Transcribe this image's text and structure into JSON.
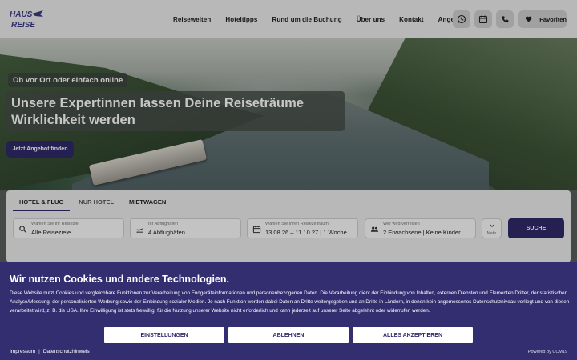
{
  "header": {
    "logo_text_top": "HAUS",
    "logo_text_bottom": "REISE",
    "nav": [
      "Reisewelten",
      "Hoteltipps",
      "Rund um die Buchung",
      "Über uns",
      "Kontakt",
      "Angebote"
    ],
    "icons": [
      "whatsapp-icon",
      "calendar-icon",
      "phone-icon"
    ],
    "favorites_label": "Favoriten"
  },
  "hero": {
    "tagline": "Ob vor Ort oder einfach online",
    "headline_line1": "Unsere Expertinnen lassen Deine Reiseträume",
    "headline_line2": "Wirklichkeit werden",
    "cta": "Jetzt Angebot finden"
  },
  "search": {
    "tabs": [
      "HOTEL & FLUG",
      "NUR HOTEL",
      "MIETWAGEN"
    ],
    "active_tab": "HOTEL & FLUG",
    "destination": {
      "label": "Wählen Sie Ihr Reiseziel",
      "value": "Alle Reiseziele"
    },
    "departure": {
      "label": "Ihr Abflughafen",
      "value": "4 Abflughäfen"
    },
    "dates": {
      "label": "Wählen Sie Ihren Reisezeitraum",
      "value": "13.08.26 – 11.10.27 | 1 Woche"
    },
    "travellers": {
      "label": "Wer wird verreisen",
      "value": "2 Erwachsene | Keine Kinder"
    },
    "more_label": "Mehr",
    "submit": "SUCHE"
  },
  "cookie": {
    "title": "Wir nutzen Cookies und andere Technologien.",
    "text": "Diese Website nutzt Cookies und vergleichbare Funktionen zur Verarbeitung von Endgeräteinformationen und personenbezogenen Daten. Die Verarbeitung dient der Einbindung von Inhalten, externen Diensten und Elementen Dritter, der statistischen Analyse/Messung, der personalisierten Werbung sowie der Einbindung sozialer Medien. Je nach Funktion werden dabei Daten an Dritte weitergegeben und an Dritte in Ländern, in denen kein angemessenes Datenschutzniveau vorliegt und von diesen verarbeitet wird, z. B. die USA. Ihre Einwilligung ist stets freiwillig, für die Nutzung unserer Website nicht erforderlich und kann jederzeit auf unserer Seite abgelehnt oder widerrufen werden.",
    "buttons": {
      "settings": "EINSTELLUNGEN",
      "reject": "ABLEHNEN",
      "accept": "ALLES AKZEPTIEREN"
    },
    "imprint": "Impressum",
    "separator": "|",
    "privacy": "Datenschutzhinweis",
    "powered": "Powered by CCM19"
  },
  "colors": {
    "brand": "#332e70",
    "button_dark": "#2f2b69",
    "header_bg": "#ececec",
    "panel_bg": "#ececec"
  }
}
